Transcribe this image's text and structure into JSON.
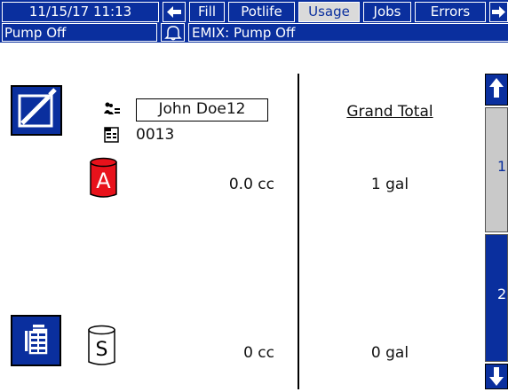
{
  "topbar": {
    "datetime": "11/15/17 11:13",
    "tabs": [
      {
        "label": "Fill",
        "active": false
      },
      {
        "label": "Potlife",
        "active": false
      },
      {
        "label": "Usage",
        "active": true
      },
      {
        "label": "Jobs",
        "active": false
      },
      {
        "label": "Errors",
        "active": false
      }
    ]
  },
  "statusbar": {
    "status": "Pump Off",
    "alarm": "EMIX: Pump Off"
  },
  "job": {
    "user": "John Doe12",
    "job_number": "0013"
  },
  "usage": {
    "a_label": "A",
    "a_value": "0.0 cc",
    "s_label": "S",
    "s_value": "0 cc"
  },
  "grand_total": {
    "title": "Grand Total",
    "a_total": "1 gal",
    "s_total": "0 gal"
  },
  "side_nav": {
    "btn1_label": "1",
    "btn2_label": "2"
  },
  "colors": {
    "bar_blue": "#0a2f9e",
    "cylinder_red": "#e8121b"
  }
}
